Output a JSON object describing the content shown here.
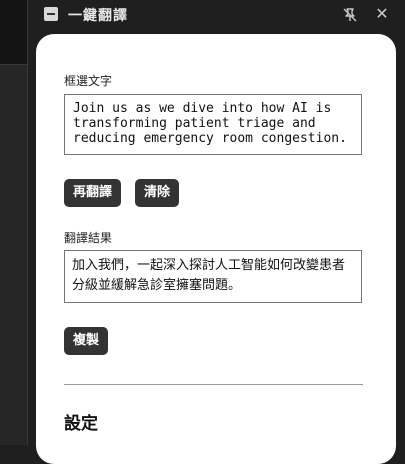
{
  "window": {
    "title": "一鍵翻譯",
    "app_icon": "app-icon",
    "pin_icon": "pin-off-icon",
    "close_icon": "close-icon",
    "close_glyph": "✕"
  },
  "source": {
    "label": "框選文字",
    "text": "Join us as we dive into how AI is transforming patient triage and reducing emergency room congestion."
  },
  "actions": {
    "retranslate_label": "再翻譯",
    "clear_label": "清除"
  },
  "result": {
    "label": "翻譯結果",
    "text": "加入我們，一起深入探討人工智能如何改變患者分級並緩解急診室擁塞問題。"
  },
  "copy": {
    "label": "複製"
  },
  "settings": {
    "title": "設定"
  },
  "colors": {
    "button_bg": "#333333",
    "panel_bg": "#ffffff",
    "window_bg": "#1f1f1f"
  }
}
